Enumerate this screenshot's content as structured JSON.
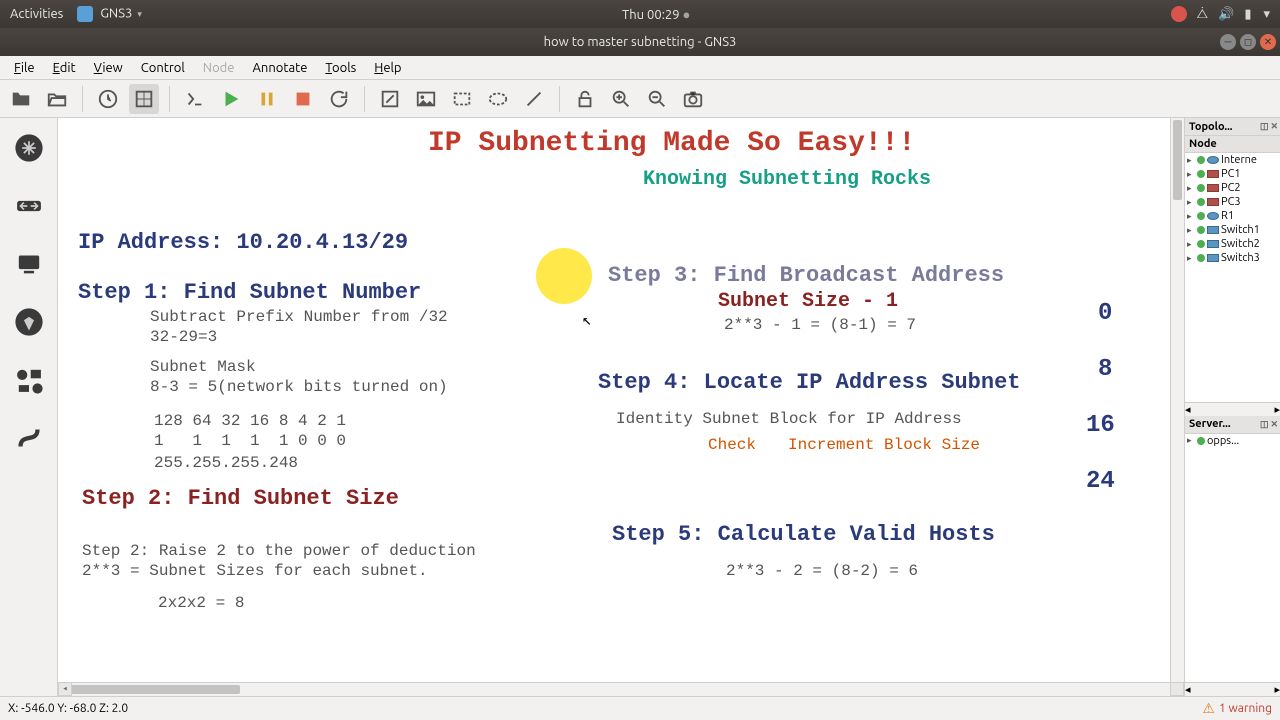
{
  "gnome": {
    "activities": "Activities",
    "app_name": "GNS3",
    "clock": "Thu 00:29"
  },
  "window": {
    "title": "how to master subnetting - GNS3"
  },
  "menu": {
    "file": "File",
    "edit": "Edit",
    "view": "View",
    "control": "Control",
    "node": "Node",
    "annotate": "Annotate",
    "tools": "Tools",
    "help": "Help"
  },
  "topology": {
    "panel_title": "Topolo...",
    "node_header": "Node",
    "items": [
      {
        "name": "Interne",
        "icon": "router"
      },
      {
        "name": "PC1",
        "icon": "monitor"
      },
      {
        "name": "PC2",
        "icon": "monitor"
      },
      {
        "name": "PC3",
        "icon": "monitor"
      },
      {
        "name": "R1",
        "icon": "router"
      },
      {
        "name": "Switch1",
        "icon": "switch"
      },
      {
        "name": "Switch2",
        "icon": "switch"
      },
      {
        "name": "Switch3",
        "icon": "switch"
      }
    ]
  },
  "servers": {
    "panel_title": "Server...",
    "items": [
      {
        "name": "opps..."
      }
    ]
  },
  "status": {
    "coords": "X: -546.0 Y: -68.0 Z: 2.0",
    "warning": "1 warning"
  },
  "canvas": {
    "title": "IP Subnetting Made So Easy!!!",
    "subtitle": "Knowing Subnetting Rocks",
    "ip_label": "IP Address: 10.20.4.13/29",
    "step1_hdr": "Step 1: Find Subnet Number",
    "step1_sub": "Subtract Prefix Number from /32",
    "step1_calc": "32-29=3",
    "step1_mask_lbl": "Subnet Mask",
    "step1_mask_calc": "8-3 = 5(network bits turned on)",
    "step1_bits1": "128 64 32 16 8 4 2 1",
    "step1_bits2": "1   1  1  1  1 0 0 0",
    "step1_mask": "255.255.255.248",
    "step2_hdr": "Step 2: Find Subnet Size",
    "step2_line1": "Step 2: Raise 2 to the power of deduction",
    "step2_line2": "2**3 = Subnet Sizes for each subnet.",
    "step2_calc": "2x2x2 = 8",
    "step3_hdr": "Step 3: Find Broadcast Address",
    "step3_sub": "Subnet Size - 1",
    "step3_calc": "2**3 - 1 = (8-1) = 7",
    "step4_hdr": "Step 4: Locate IP Address Subnet",
    "step4_line1": "Identity Subnet Block for IP Address",
    "step4_check": "Check",
    "step4_inc": "Increment Block Size",
    "step5_hdr": "Step 5: Calculate Valid Hosts",
    "step5_calc": "2**3 - 2 = (8-2) = 6",
    "blocks": {
      "b0": "0",
      "b8": "8",
      "b16": "16",
      "b24": "24"
    }
  }
}
